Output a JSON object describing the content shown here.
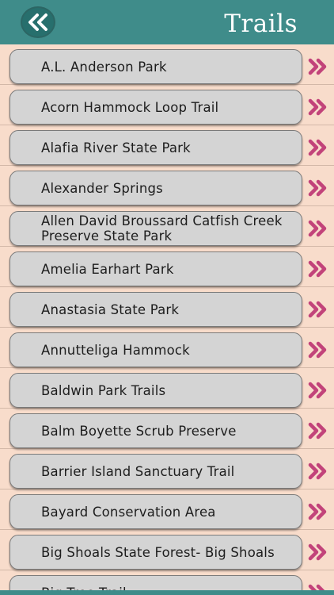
{
  "header": {
    "title": "Trails",
    "back_icon": "double-chevron-left-icon"
  },
  "colors": {
    "header": "#3f8c8a",
    "background": "#f8dccb",
    "row_button": "#d4d4d4",
    "chevron": "#c2437a"
  },
  "trails": [
    {
      "label": "A.L. Anderson Park"
    },
    {
      "label": "Acorn Hammock Loop Trail"
    },
    {
      "label": "Alafia River State Park"
    },
    {
      "label": "Alexander Springs"
    },
    {
      "label": "Allen David Broussard Catfish Creek Preserve State Park"
    },
    {
      "label": "Amelia Earhart Park"
    },
    {
      "label": "Anastasia State Park"
    },
    {
      "label": "Annutteliga Hammock"
    },
    {
      "label": "Baldwin Park Trails"
    },
    {
      "label": "Balm Boyette Scrub Preserve"
    },
    {
      "label": "Barrier Island Sanctuary Trail"
    },
    {
      "label": "Bayard Conservation Area"
    },
    {
      "label": "Big Shoals State Forest- Big Shoals"
    },
    {
      "label": "Big Tree Trail"
    }
  ]
}
